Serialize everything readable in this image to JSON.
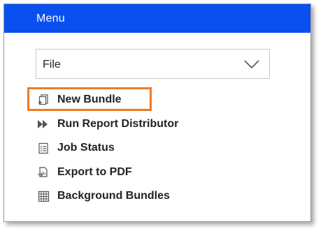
{
  "menu": {
    "title": "Menu",
    "header_color": "#0a50f0",
    "dropdown": {
      "selected": "File",
      "icon": "chevron-down-icon"
    },
    "items": [
      {
        "label": "New Bundle",
        "icon": "new-bundle-icon",
        "highlighted": true
      },
      {
        "label": "Run Report Distributor",
        "icon": "fast-forward-icon",
        "highlighted": false
      },
      {
        "label": "Job Status",
        "icon": "job-status-icon",
        "highlighted": false
      },
      {
        "label": "Export to PDF",
        "icon": "export-pdf-icon",
        "highlighted": false
      },
      {
        "label": "Background Bundles",
        "icon": "grid-icon",
        "highlighted": false
      }
    ],
    "highlight_color": "#f07a22"
  }
}
